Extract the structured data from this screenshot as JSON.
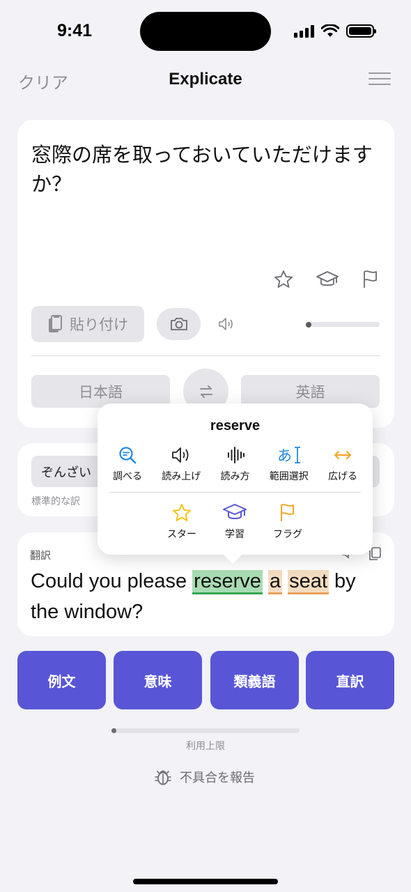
{
  "status": {
    "time": "9:41"
  },
  "nav": {
    "clear": "クリア",
    "title": "Explicate"
  },
  "input": {
    "text": "窓際の席を取っておいていただけますか？",
    "paste_label": "貼り付け",
    "source_lang": "日本語",
    "target_lang": "英語"
  },
  "formality": {
    "selected": "ぞんざい",
    "label": "標準的な訳"
  },
  "translation": {
    "label": "翻訳",
    "before": "Could you please ",
    "word1": "reserve",
    "word2": "a",
    "word3": "seat",
    "after": " by the window?"
  },
  "popup": {
    "word": "reserve",
    "actions": [
      {
        "label": "調べる",
        "icon": "search-icon",
        "color": "#1e88e5"
      },
      {
        "label": "読み上げ",
        "icon": "speaker-icon",
        "color": "#222222"
      },
      {
        "label": "読み方",
        "icon": "waveform-icon",
        "color": "#222222"
      },
      {
        "label": "範囲選択",
        "icon": "text-select-icon",
        "color": "#1e88e5"
      },
      {
        "label": "広げる",
        "icon": "expand-icon",
        "color": "#f5a623"
      }
    ],
    "secondary": [
      {
        "label": "スター",
        "icon": "star-icon",
        "color": "#f5c518"
      },
      {
        "label": "学習",
        "icon": "graduation-cap-icon",
        "color": "#5856d6"
      },
      {
        "label": "フラグ",
        "icon": "flag-icon",
        "color": "#f5a623"
      }
    ]
  },
  "buttons": {
    "examples": "例文",
    "meaning": "意味",
    "synonyms": "類義語",
    "literal": "直訳"
  },
  "usage": {
    "label": "利用上限",
    "fraction": 0.02
  },
  "report": {
    "label": "不具合を報告"
  },
  "colors": {
    "accent": "#5856d6",
    "background": "#f2f2f7",
    "highlight_green": "#a8dcb2",
    "highlight_orange": "#f4dcc0"
  }
}
